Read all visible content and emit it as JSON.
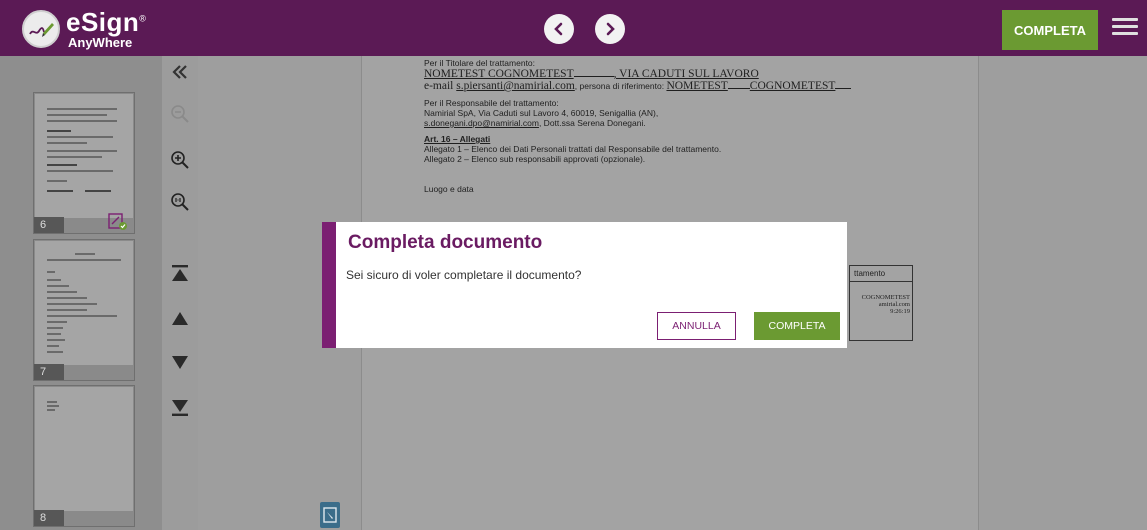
{
  "app": {
    "logo_main": "eSign",
    "logo_sub": "AnyWhere",
    "logo_reg": "®"
  },
  "header": {
    "prev_icon": "chevron-left-icon",
    "next_icon": "chevron-right-icon",
    "complete_label": "COMPLETA",
    "menu_icon": "hamburger-menu-icon"
  },
  "thumbnails": [
    {
      "page": "6"
    },
    {
      "page": "7"
    },
    {
      "page": "8"
    }
  ],
  "document": {
    "line1": "Per il Titolare del trattamento:",
    "line2_name": "NOMETEST COGNOMETEST",
    "line2_addr": ", VIA CADUTI SUL LAVORO",
    "line3_prefix": "e-mail ",
    "line3_email": "s.piersanti@namirial.com",
    "line3_mid": ", persona di riferimento: ",
    "line3_ref1": "NOMETEST",
    "line3_ref2": "COGNOMETEST",
    "resp1": "Per il Responsabile del trattamento:",
    "resp2": "Namirial SpA, Via Caduti sul Lavoro 4, 60019, Senigallia (AN),",
    "resp3_email": "s.donegani.dpo@namirial.com",
    "resp3_rest": ", Dott.ssa Serena Donegani.",
    "art_title": "Art. 16 – Allegati",
    "art1": "Allegato 1 – Elenco dei Dati Personali trattati dal Responsabile del trattamento.",
    "art2": "Allegato 2 – Elenco sub responsabili approvati (opzionale).",
    "place_date": "Luogo e data",
    "sig_header": "ttamento",
    "sig_name": "COGNOMETEST",
    "sig_mail": "amirial.com",
    "sig_time": "9:26:19"
  },
  "dialog": {
    "title": "Completa documento",
    "message": "Sei sicuro di voler completare il documento?",
    "cancel_label": "ANNULLA",
    "confirm_label": "COMPLETA"
  },
  "colors": {
    "header_bg": "#5b1a55",
    "accent_purple": "#7b1f72",
    "accent_green": "#6b9a32"
  }
}
